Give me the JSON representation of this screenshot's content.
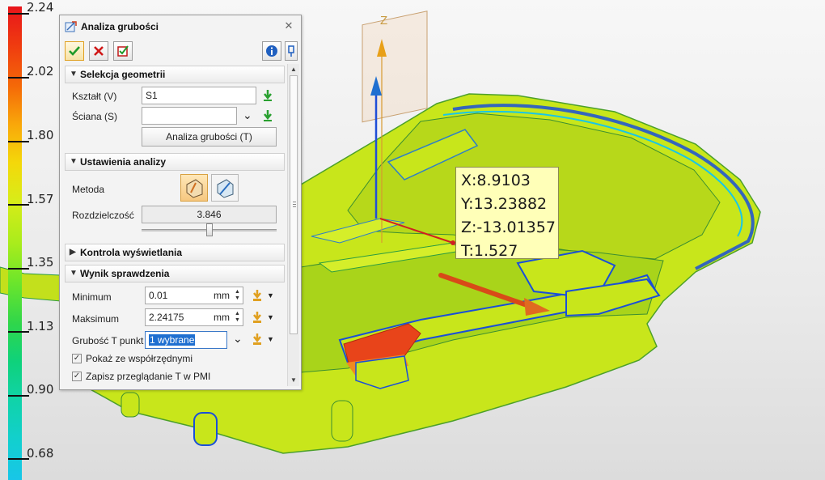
{
  "legend": {
    "labels": [
      "2.24",
      "2.02",
      "1.80",
      "1.57",
      "1.35",
      "1.13",
      "0.90",
      "0.68"
    ]
  },
  "viewport": {
    "axis_label": "Z"
  },
  "callout": {
    "x": "X:8.9103",
    "y": "Y:13.23882",
    "z": "Z:-13.01357",
    "t": "T:1.527"
  },
  "dialog": {
    "title": "Analiza grubości",
    "close_glyph": "✕",
    "toolbar": {
      "ok_icon": "checkmark-icon",
      "cancel_icon": "x-icon",
      "apply_icon": "apply-check-icon",
      "info_icon": "info-icon",
      "pin_icon": "pin-icon"
    },
    "sections": {
      "geometry": {
        "header": "Selekcja geometrii",
        "shape_label": "Kształt (V)",
        "shape_value": "S1",
        "face_label": "Ściana (S)",
        "face_value": "",
        "analyze_button": "Analiza grubości (T)"
      },
      "settings": {
        "header": "Ustawienia analizy",
        "method_label": "Metoda",
        "resolution_label": "Rozdzielczość",
        "resolution_value": "3.846",
        "slider_fraction": 0.5
      },
      "display": {
        "header": "Kontrola wyświetlania"
      },
      "result": {
        "header": "Wynik sprawdzenia",
        "min_label": "Minimum",
        "min_value": "0.01",
        "max_label": "Maksimum",
        "max_value": "2.24175",
        "unit": "mm",
        "point_label": "Grubość T punkt",
        "point_value": "1 wybrane",
        "show_coords_label": "Pokaż ze współrzędnymi",
        "show_coords_checked": true,
        "save_pmi_label": "Zapisz przeglądanie T w PMI",
        "save_pmi_checked": true
      }
    }
  },
  "colors": {
    "part_base": "#c9e81a",
    "thin_wall": "#1a4fd8",
    "thick_wall": "#e8441a",
    "callout_bg": "#ffffb8",
    "accent_blue": "#1f6fd0"
  }
}
